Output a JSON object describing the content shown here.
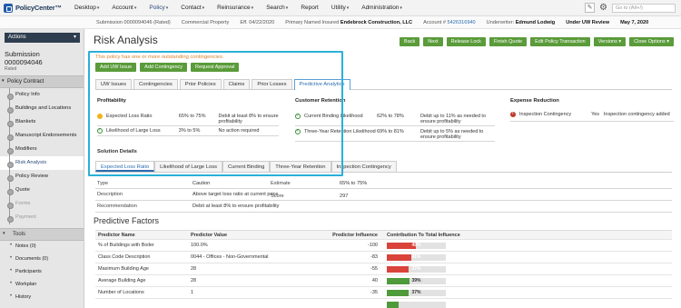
{
  "app": {
    "name": "PolicyCenter™"
  },
  "menu": [
    {
      "label": "Desktop",
      "dropdown": true
    },
    {
      "label": "Account",
      "dropdown": true
    },
    {
      "label": "Policy",
      "dropdown": true,
      "active": true
    },
    {
      "label": "Contact",
      "dropdown": true
    },
    {
      "label": "Reinsurance",
      "dropdown": true
    },
    {
      "label": "Search",
      "dropdown": true
    },
    {
      "label": "Report",
      "dropdown": false
    },
    {
      "label": "Utility",
      "dropdown": true
    },
    {
      "label": "Administration",
      "dropdown": true
    }
  ],
  "search": {
    "placeholder": "Go to (Alt+/)"
  },
  "infobar": {
    "submission": "Submission 0000094046 (Rated)",
    "product": "Commercial Property",
    "eff_label": "Eff.",
    "eff_date": "04/22/2020",
    "insured_label": "Primary Named Insured",
    "insured": "Endebrock Construction, LLC",
    "account_label": "Account #",
    "account": "5426316940",
    "underwriter_label": "Underwriter:",
    "underwriter": "Edmund Lodwig",
    "status": "Under UW Review",
    "date": "May 7, 2020"
  },
  "sidebar": {
    "actions": "Actions",
    "submission_title": "Submission 0000094046",
    "submission_status": "Rated",
    "section": "Policy Contract",
    "items": [
      {
        "label": "Policy Info"
      },
      {
        "label": "Buildings and Locations"
      },
      {
        "label": "Blankets"
      },
      {
        "label": "Manuscript Endorsements"
      },
      {
        "label": "Modifiers"
      },
      {
        "label": "Risk Analysis"
      },
      {
        "label": "Policy Review"
      },
      {
        "label": "Quote"
      },
      {
        "label": "Forms"
      },
      {
        "label": "Payment"
      }
    ],
    "tools_label": "Tools",
    "tools": [
      {
        "label": "Notes (0)"
      },
      {
        "label": "Documents (0)"
      },
      {
        "label": "Participants"
      },
      {
        "label": "Workplan"
      },
      {
        "label": "History"
      }
    ]
  },
  "page": {
    "title": "Risk Analysis",
    "toolbar": {
      "back": "Back",
      "next": "Next",
      "release_lock": "Release Lock",
      "finish_quote": "Finish Quote",
      "edit_transaction": "Edit Policy Transaction",
      "versions": "Versions",
      "close_options": "Close Options"
    },
    "warning": "This policy has one or more outstanding contingencies.",
    "actions": {
      "add_uw_issue": "Add UW Issue",
      "add_contingency": "Add Contingency",
      "request_approval": "Request Approval"
    },
    "tabs": [
      "UW Issues",
      "Contingencies",
      "Prior Policies",
      "Claims",
      "Prior Losses",
      "Predictive Analytics"
    ],
    "profitability": {
      "title": "Profitability",
      "rows": [
        {
          "label": "Expected Loss Ratio",
          "range": "65% to 75%",
          "note": "Debit at least 8% to ensure profitability"
        },
        {
          "label": "Likelihood of Large Loss",
          "range": "3% to 5%",
          "note": "No action required"
        }
      ]
    },
    "retention": {
      "title": "Customer Retention",
      "rows": [
        {
          "label": "Current Binding Likelihood",
          "range": "62% to 78%",
          "note": "Debit up to 11% as needed to ensure profitability"
        },
        {
          "label": "Three-Year Retention Likelihood",
          "range": "69% to 81%",
          "note": "Debit up to 5% as needed to ensure profitability"
        }
      ]
    },
    "expense": {
      "title": "Expense Reduction",
      "rows": [
        {
          "label": "Inspection Contingency",
          "range": "Yes",
          "note": "Inspection contingency added"
        }
      ]
    },
    "solution": {
      "title": "Solution Details",
      "tabs": [
        "Expected Loss Ratio",
        "Likelihood of Large Loss",
        "Current Binding",
        "Three-Year Retention",
        "Inspection Contingency"
      ],
      "type_label": "Type",
      "type": "Caution",
      "description_label": "Description",
      "description": "Above target loss ratio at current price",
      "recommendation_label": "Recommendation",
      "recommendation": "Debit at least 8% to ensure profitability",
      "estimate_label": "Estimate",
      "estimate": "65% to 75%",
      "score_label": "Score",
      "score": "297"
    },
    "predictive": {
      "title": "Predictive Factors",
      "columns": [
        "Predictor Name",
        "Predictor Value",
        "Predictor Influence",
        "Contribution To Total Influence"
      ],
      "rows": [
        {
          "name": "% of Buildings with Boiler",
          "value": "100.0%",
          "influence": "-100",
          "contribution": "49%",
          "pct": 0.49,
          "color": "#d9433a"
        },
        {
          "name": "Class Code Description",
          "value": "0044 - Offices - Non-Governmental",
          "influence": "-83",
          "contribution": "41%",
          "pct": 0.41,
          "color": "#d9433a"
        },
        {
          "name": "Maximum Building Age",
          "value": "28",
          "influence": "-55",
          "contribution": "37%",
          "pct": 0.37,
          "color": "#d9433a"
        },
        {
          "name": "Average Building Age",
          "value": "28",
          "influence": "40",
          "contribution": "39%",
          "pct": 0.39,
          "color": "#4f9a3a"
        },
        {
          "name": "Number of Locations",
          "value": "1",
          "influence": "-35",
          "contribution": "37%",
          "pct": 0.37,
          "color": "#4f9a3a"
        },
        {
          "name": "",
          "value": "",
          "influence": "",
          "contribution": "",
          "pct": 0.2,
          "color": "#4f9a3a"
        }
      ]
    }
  }
}
